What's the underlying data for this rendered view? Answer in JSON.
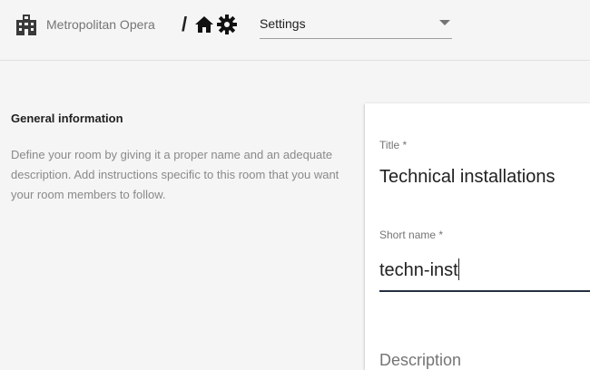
{
  "header": {
    "org_name": "Metropolitan Opera",
    "separator": "/",
    "settings_select": {
      "value": "Settings"
    }
  },
  "general": {
    "title": "General information",
    "description": "Define your room by giving it a proper name and an adequate description. Add instructions specific to this room that you want your room members to follow."
  },
  "form": {
    "title_label": "Title *",
    "title_value": "Technical installations",
    "short_name_label": "Short name *",
    "short_name_value": "techn-inst",
    "description_label": "Description"
  },
  "icons": [
    "building-icon",
    "home-icon",
    "gear-icon",
    "chevron-down-icon"
  ],
  "colors": {
    "background": "#f5f5f5",
    "card": "#ffffff",
    "active_underline": "#263040"
  }
}
